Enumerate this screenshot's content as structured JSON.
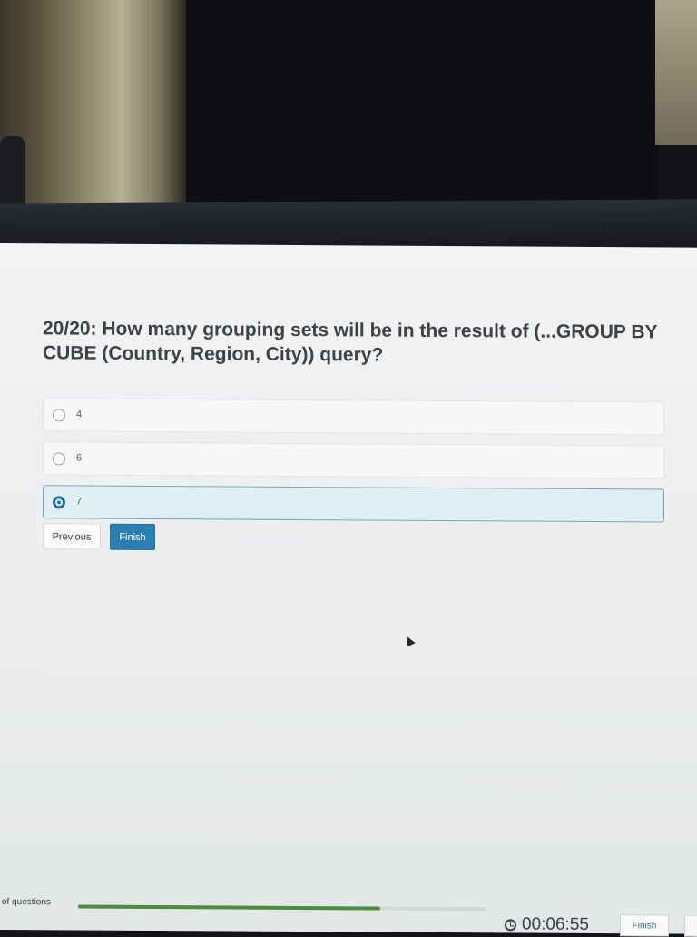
{
  "quiz": {
    "question": "20/20: How many grouping sets will be in the result of (...GROUP BY CUBE (Country, Region, City)) query?",
    "options": [
      {
        "label": "4",
        "selected": false
      },
      {
        "label": "6",
        "selected": false
      },
      {
        "label": "7",
        "selected": true
      }
    ],
    "previous_label": "Previous",
    "finish_label": "Finish"
  },
  "footer": {
    "questions_label": "of questions",
    "progress_fraction": 0.74,
    "timer": "00:06:55",
    "finish_label": "Finish"
  },
  "colors": {
    "accent": "#2a7fb3",
    "progress": "#4c8c3d",
    "selected_bg": "#dfeff3"
  },
  "icons": [
    "radio-icon",
    "clock-icon",
    "cursor-icon"
  ]
}
